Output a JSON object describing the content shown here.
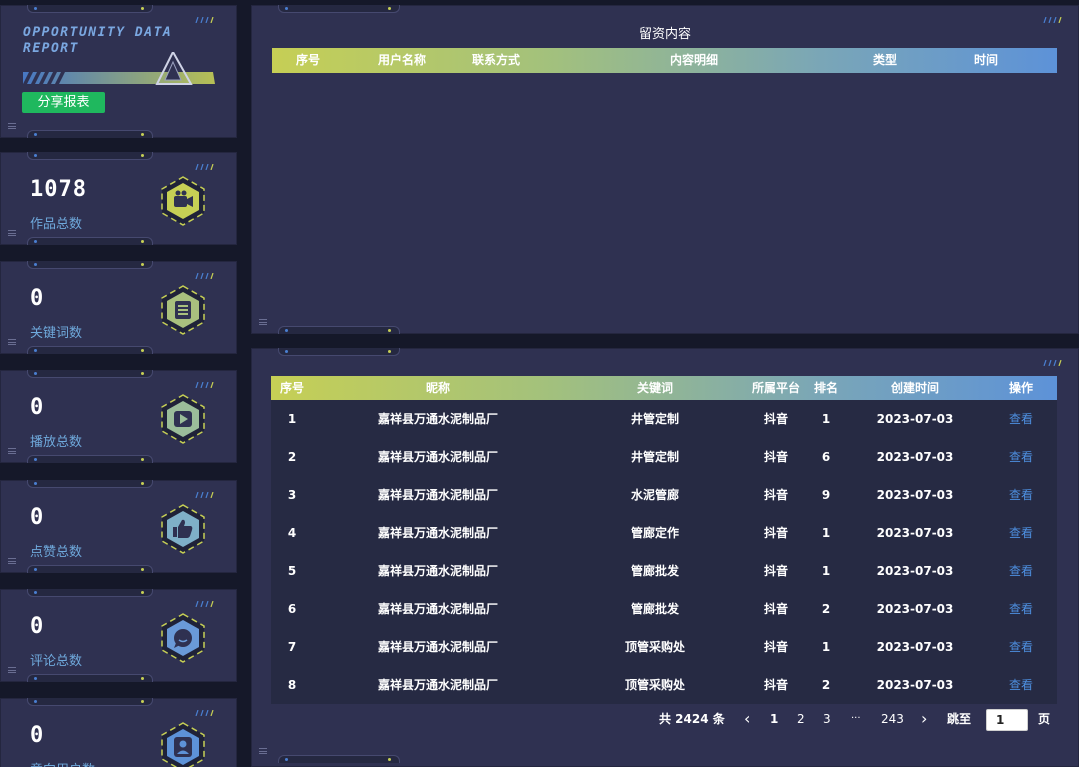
{
  "report": {
    "title_line1": "OPPORTUNITY DATA",
    "title_line2": "REPORT",
    "share_label": "分享报表"
  },
  "stats": [
    {
      "value": "1078",
      "label": "作品总数",
      "icon": "video-icon"
    },
    {
      "value": "0",
      "label": "关键词数",
      "icon": "list-icon"
    },
    {
      "value": "0",
      "label": "播放总数",
      "icon": "play-icon"
    },
    {
      "value": "0",
      "label": "点赞总数",
      "icon": "thumbs-up-icon"
    },
    {
      "value": "0",
      "label": "评论总数",
      "icon": "comment-icon"
    },
    {
      "value": "0",
      "label": "意向用户数",
      "icon": "user-icon"
    }
  ],
  "leads": {
    "title": "留资内容",
    "columns": [
      "序号",
      "用户名称",
      "联系方式",
      "内容明细",
      "类型",
      "时间"
    ]
  },
  "ranking": {
    "columns": [
      "序号",
      "昵称",
      "关键词",
      "所属平台",
      "排名",
      "创建时间",
      "操作"
    ],
    "rows": [
      {
        "index": "1",
        "name": "嘉祥县万通水泥制品厂",
        "keyword": "井管定制",
        "platform": "抖音",
        "rank": "1",
        "created": "2023-07-03",
        "action": "查看"
      },
      {
        "index": "2",
        "name": "嘉祥县万通水泥制品厂",
        "keyword": "井管定制",
        "platform": "抖音",
        "rank": "6",
        "created": "2023-07-03",
        "action": "查看"
      },
      {
        "index": "3",
        "name": "嘉祥县万通水泥制品厂",
        "keyword": "水泥管廊",
        "platform": "抖音",
        "rank": "9",
        "created": "2023-07-03",
        "action": "查看"
      },
      {
        "index": "4",
        "name": "嘉祥县万通水泥制品厂",
        "keyword": "管廊定作",
        "platform": "抖音",
        "rank": "1",
        "created": "2023-07-03",
        "action": "查看"
      },
      {
        "index": "5",
        "name": "嘉祥县万通水泥制品厂",
        "keyword": "管廊批发",
        "platform": "抖音",
        "rank": "1",
        "created": "2023-07-03",
        "action": "查看"
      },
      {
        "index": "6",
        "name": "嘉祥县万通水泥制品厂",
        "keyword": "管廊批发",
        "platform": "抖音",
        "rank": "2",
        "created": "2023-07-03",
        "action": "查看"
      },
      {
        "index": "7",
        "name": "嘉祥县万通水泥制品厂",
        "keyword": "顶管采购处",
        "platform": "抖音",
        "rank": "1",
        "created": "2023-07-03",
        "action": "查看"
      },
      {
        "index": "8",
        "name": "嘉祥县万通水泥制品厂",
        "keyword": "顶管采购处",
        "platform": "抖音",
        "rank": "2",
        "created": "2023-07-03",
        "action": "查看"
      }
    ]
  },
  "pagination": {
    "total_text": "共 2424 条",
    "prev": "‹",
    "pages": [
      "1",
      "2",
      "3"
    ],
    "ellipsis": "···",
    "last_page": "243",
    "next": "›",
    "jump_label": "跳至",
    "jump_value": "1",
    "page_suffix": "页"
  },
  "colors": {
    "accent_yellow": "#c6cf55",
    "accent_blue": "#5d92d8",
    "share_green": "#1fb85e",
    "link_blue": "#4d8fe0"
  }
}
